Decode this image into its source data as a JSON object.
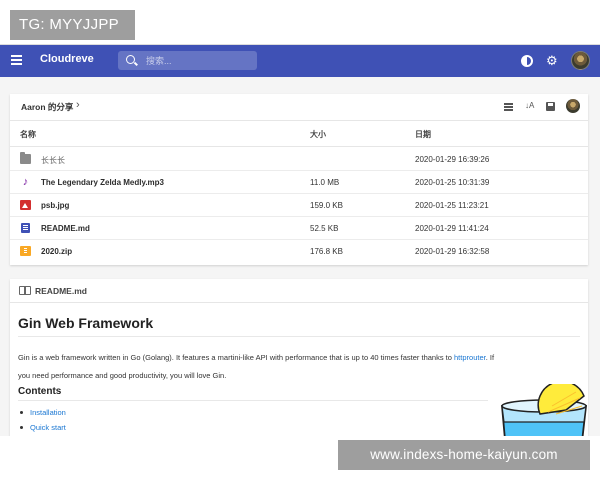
{
  "watermarks": {
    "top": "TG: MYYJJPP",
    "bottom": "www.indexs-home-kaiyun.com"
  },
  "appbar": {
    "brand": "Cloudreve",
    "search_placeholder": "搜索...",
    "accent": "#3f51b5"
  },
  "explorer": {
    "breadcrumb": "Aaron 的分享",
    "columns": {
      "name": "名称",
      "size": "大小",
      "date": "日期"
    },
    "files": [
      {
        "name": "长长长",
        "size": "",
        "date": "2020-01-29 16:39:26",
        "icon": "folder-icon"
      },
      {
        "name": "The Legendary Zelda Medly.mp3",
        "size": "11.0 MB",
        "date": "2020-01-25 10:31:39",
        "icon": "music-file-icon"
      },
      {
        "name": "psb.jpg",
        "size": "159.0 KB",
        "date": "2020-01-25 11:23:21",
        "icon": "image-file-icon"
      },
      {
        "name": "README.md",
        "size": "52.5 KB",
        "date": "2020-01-29 11:41:24",
        "icon": "document-file-icon"
      },
      {
        "name": "2020.zip",
        "size": "176.8 KB",
        "date": "2020-01-29 16:32:58",
        "icon": "zip-file-icon"
      }
    ]
  },
  "readme": {
    "filename": "README.md",
    "heading": "Gin Web Framework",
    "para_before_link": "Gin is a web framework written in Go (Golang). It features a martini-like API with performance that is up to 40 times faster thanks to ",
    "para_link": "httprouter",
    "para_after_link": ". If you need performance and good productivity, you will love Gin.",
    "contents_heading": "Contents",
    "toc": [
      "Installation",
      "Quick start"
    ]
  }
}
